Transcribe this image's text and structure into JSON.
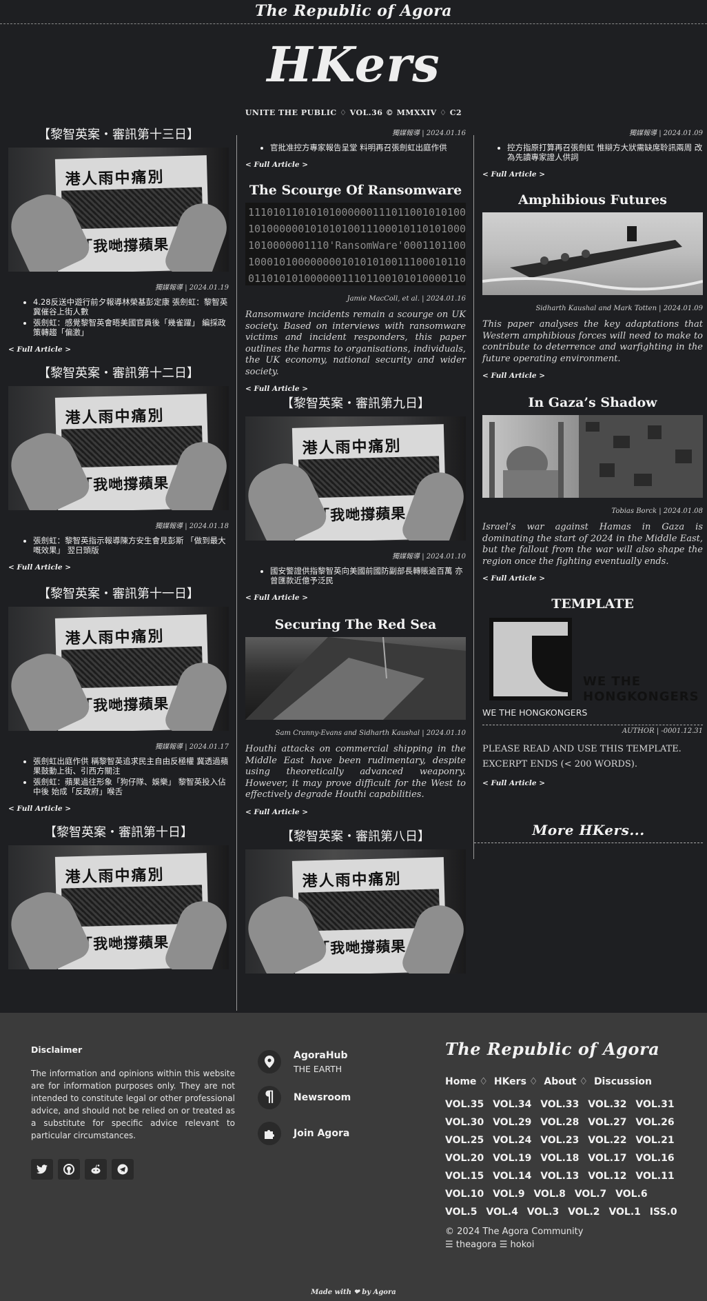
{
  "site": {
    "name": "The Republic of Agora",
    "masthead": "HKers",
    "tagline": "UNITE THE PUBLIC ♢ VOL.36 © MMXXIV ♢ C2"
  },
  "col1": [
    {
      "title": "【黎智英案・審訊第十三日】",
      "meta": "獨媒報導 | 2024.01.19",
      "bullets": [
        "4.28反送中遊行前夕報導林榮基彭定康 張劍虹：黎智英冀催谷上街人數",
        "張劍虹：感覺黎智英會晤美國官員後「幾雀躍」 編採政策轉趨「偏激」"
      ],
      "more": "< Full Article >"
    },
    {
      "title": "【黎智英案・審訊第十二日】",
      "meta": "獨媒報導 | 2024.01.18",
      "bullets": [
        "張劍虹：黎智英指示報導陳方安生會見彭斯 「做到最大嘅效果」 翌日頭版"
      ],
      "more": "< Full Article >"
    },
    {
      "title": "【黎智英案・審訊第十一日】",
      "meta": "獨媒報導 | 2024.01.17",
      "bullets": [
        "張劍虹出庭作供 稱黎智英追求民主自由反極權 冀透過蘋果鼓動上街、引西方關注",
        "張劍虹：蘋果過往形象「狗仔隊、娛樂」 黎智英投入佔中後 始成「反政府」喉舌"
      ],
      "more": "< Full Article >"
    },
    {
      "title": "【黎智英案・審訊第十日】"
    }
  ],
  "col2": [
    {
      "meta": "獨媒報導 | 2024.01.16",
      "bullets": [
        "官批准控方專家報告呈堂 料明再召張劍虹出庭作供"
      ],
      "more": "< Full Article >"
    },
    {
      "title": "The Scourge Of Ransomware",
      "binary": "111010110101010000001110110010101000011\n1010000001010101001110001011010100001101\n1010000001110'RansomWare'0001101100001100\n1000101000000001010101001110001011010000\n0110101010000001110110010101000011000011",
      "meta": "Jamie MacColl, et al. | 2024.01.16",
      "excerpt": "Ransomware incidents remain a scourge on UK society. Based on interviews with ransomware victims and incident responders, this paper outlines the harms to organisations, individuals, the UK economy, national security and wider society.",
      "more": "< Full Article >"
    },
    {
      "title": "【黎智英案・審訊第九日】",
      "meta": "獨媒報導 | 2024.01.10",
      "bullets": [
        "國安警證供指黎智英向美國前國防副部長轉賬逾百萬 亦曾匯款近億予泛民"
      ],
      "more": "< Full Article >"
    },
    {
      "title": "Securing The Red Sea",
      "meta": "Sam Cranny-Evans and Sidharth Kaushal | 2024.01.10",
      "excerpt": "Houthi attacks on commercial shipping in the Middle East have been rudimentary, despite using theoretically advanced weaponry. However, it may prove difficult for the West to effectively degrade Houthi capabilities.",
      "more": "< Full Article >"
    },
    {
      "title": "【黎智英案・審訊第八日】"
    }
  ],
  "col3": [
    {
      "meta": "獨媒報導 | 2024.01.09",
      "bullets": [
        "控方指原打算再召張劍虹 惟辯方大狀需缺席聆訊兩周 改為先讀專家證人供詞"
      ],
      "more": "< Full Article >"
    },
    {
      "title": "Amphibious Futures",
      "meta": "Sidharth Kaushal and Mark Totten | 2024.01.09",
      "excerpt": "This paper analyses the key adaptations that Western amphibious forces will need to make to contribute to deterrence and warfighting in the future operating environment.",
      "more": "< Full Article >"
    },
    {
      "title": "In Gaza’s Shadow",
      "meta": "Tobias Borck | 2024.01.08",
      "excerpt": "Israel’s war against Hamas in Gaza is dominating the start of 2024 in the Middle East, but the fallout from the war will also shape the region once the fighting eventually ends.",
      "more": "< Full Article >"
    },
    {
      "title": "TEMPLATE",
      "image_text": "WE THE HONGKONGERS",
      "caption": "WE THE HONGKONGERS",
      "meta": "AUTHOR | -0001.12.31",
      "excerpt": "PLEASE READ AND USE THIS TEMPLATE. EXCERPT ENDS (< 200 WORDS).",
      "more": "< Full Article >"
    },
    {
      "more_hkers": "More HKers..."
    }
  ],
  "newspaper_photo": {
    "headline": "港人雨中痛別",
    "bottom": "「我哋撐蘋果」"
  },
  "footer": {
    "disclaimer_title": "Disclaimer",
    "disclaimer_text": "The information and opinions within this website are for information purposes only. They are not intended to constitute legal or other professional advice, and should not be relied on or treated as a substitute for specific advice relevant to particular circumstances.",
    "socials": [
      "twitter-icon",
      "github-icon",
      "reddit-icon",
      "telegram-icon"
    ],
    "hub": [
      {
        "icon": "location-pin-icon",
        "title": "AgoraHub",
        "sub": "THE EARTH"
      },
      {
        "icon": "pilcrow-icon",
        "title": "Newsroom",
        "sub": ""
      },
      {
        "icon": "puzzle-icon",
        "title": "Join Agora",
        "sub": ""
      }
    ],
    "logo": "The Republic of Agora",
    "nav": [
      "Home",
      "HKers",
      "About",
      "Discussion"
    ],
    "nav_sep": "♢",
    "vols": [
      "VOL.35",
      "VOL.34",
      "VOL.33",
      "VOL.32",
      "VOL.31",
      "VOL.30",
      "VOL.29",
      "VOL.28",
      "VOL.27",
      "VOL.26",
      "VOL.25",
      "VOL.24",
      "VOL.23",
      "VOL.22",
      "VOL.21",
      "VOL.20",
      "VOL.19",
      "VOL.18",
      "VOL.17",
      "VOL.16",
      "VOL.15",
      "VOL.14",
      "VOL.13",
      "VOL.12",
      "VOL.11",
      "VOL.10",
      "VOL.9",
      "VOL.8",
      "VOL.7",
      "VOL.6",
      "VOL.5",
      "VOL.4",
      "VOL.3",
      "VOL.2",
      "VOL.1",
      "ISS.0"
    ],
    "copyright": "© 2024 The Agora Community",
    "credits": "☰ theagora ☰ hokoi",
    "made_with": "Made with ❤ by Agora"
  }
}
